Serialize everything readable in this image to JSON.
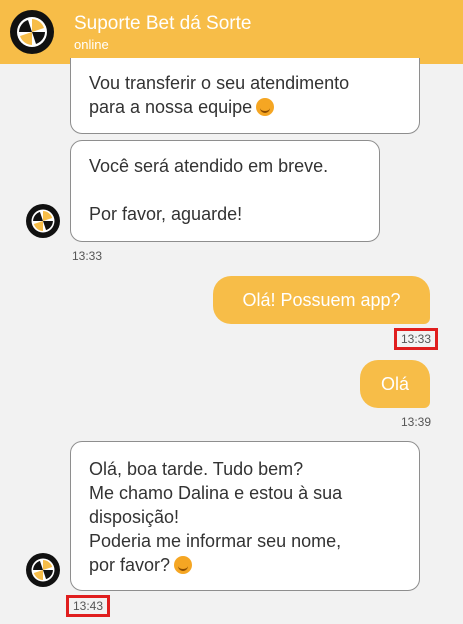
{
  "header": {
    "title": "Suporte Bet dá Sorte",
    "status": "online",
    "logo_icon": "pinwheel-logo-icon"
  },
  "colors": {
    "accent": "#f7bd48",
    "highlight_box": "#e01e1e"
  },
  "messages": [
    {
      "direction": "incoming",
      "lines": [
        "Vou transferir o seu atendimento",
        "para a nossa equipe"
      ],
      "emoji": "smiling-face-icon"
    },
    {
      "direction": "incoming",
      "lines": [
        "Você será atendido em breve.",
        "",
        "Por favor, aguarde!"
      ],
      "time": "13:33"
    },
    {
      "direction": "outgoing",
      "text": "Olá! Possuem app?",
      "time": "13:33"
    },
    {
      "direction": "outgoing",
      "text": "Olá",
      "time": "13:39"
    },
    {
      "direction": "incoming",
      "lines": [
        "Olá, boa tarde. Tudo bem?",
        "Me chamo Dalina e estou à sua",
        "disposição!",
        "Poderia me informar seu nome,",
        "por favor?"
      ],
      "emoji": "smiling-face-icon",
      "time": "13:43"
    }
  ]
}
